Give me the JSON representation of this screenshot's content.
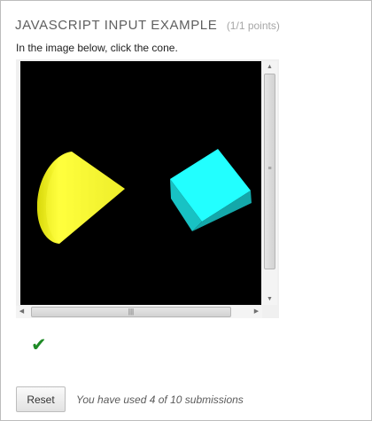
{
  "problem": {
    "title": "JAVASCRIPT INPUT EXAMPLE",
    "points": "(1/1 points)",
    "prompt": "In the image below, click the cone."
  },
  "canvas": {
    "background": "#000000",
    "objects": [
      {
        "name": "cone",
        "color": "#ffff33"
      },
      {
        "name": "cube",
        "color": "#22ffff"
      }
    ]
  },
  "scrollbars": {
    "grip": "|||",
    "vertical_grip": "≡"
  },
  "result": {
    "icon": "checkmark-icon",
    "glyph": "✔",
    "color": "#1e8a26"
  },
  "actions": {
    "reset_label": "Reset",
    "submissions_text": "You have used 4 of 10 submissions"
  }
}
